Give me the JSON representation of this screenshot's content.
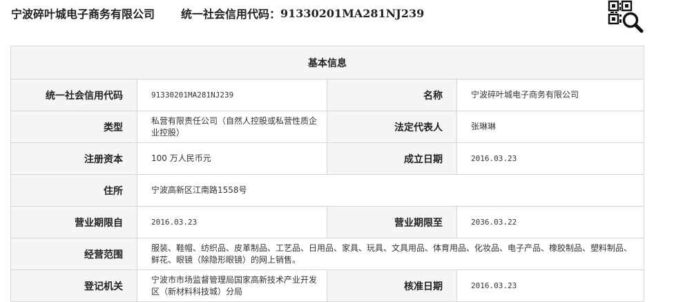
{
  "header": {
    "company_name": "宁波碎叶城电子商务有限公司",
    "credit_code_label": "统一社会信用代码：",
    "credit_code": "91330201MA281NJ239"
  },
  "qr_icon": "qr-code-search-icon",
  "section_title": "基本信息",
  "fields": {
    "credit_code": {
      "label": "统一社会信用代码",
      "value": "91330201MA281NJ239"
    },
    "name": {
      "label": "名称",
      "value": "宁波碎叶城电子商务有限公司"
    },
    "type": {
      "label": "类型",
      "value": "私营有限责任公司（自然人控股或私营性质企业控股）"
    },
    "legal_rep": {
      "label": "法定代表人",
      "value": "张琳琳"
    },
    "reg_capital": {
      "label": "注册资本",
      "value": "100 万人民币元"
    },
    "founded": {
      "label": "成立日期",
      "value": "2016.03.23"
    },
    "address": {
      "label": "住所",
      "value": "宁波高新区江南路1558号"
    },
    "term_from": {
      "label": "营业期限自",
      "value": "2016.03.23"
    },
    "term_to": {
      "label": "营业期限至",
      "value": "2036.03.22"
    },
    "scope": {
      "label": "经营范围",
      "value": "服装、鞋帽、纺织品、皮革制品、工艺品、日用品、家具、玩具、文具用品、体育用品、化妆品、电子产品、橡胶制品、塑料制品、鲜花、眼镜（除隐形眼镜）的网上销售。"
    },
    "authority": {
      "label": "登记机关",
      "value": "宁波市市场监督管理局国家高新技术产业开发区（新材料科技城）分局"
    },
    "approved": {
      "label": "核准日期",
      "value": "2016.03.23"
    }
  }
}
